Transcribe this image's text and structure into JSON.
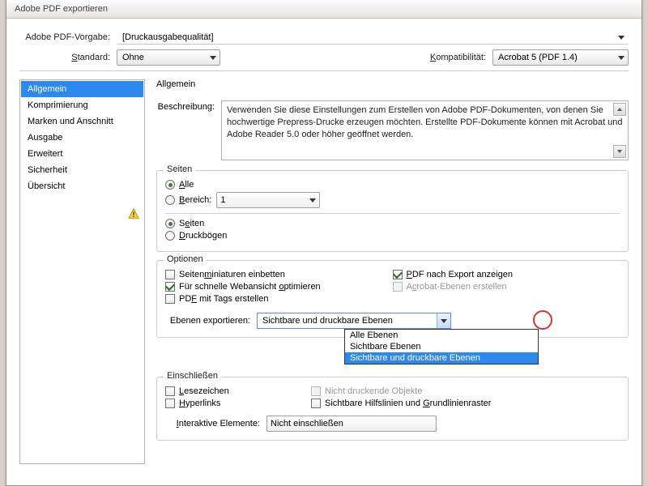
{
  "window": {
    "title": "Adobe PDF exportieren"
  },
  "preset": {
    "label": "Adobe PDF-Vorgabe:",
    "value": "[Druckausgabequalität]"
  },
  "standard": {
    "label": "Standard:",
    "value": "Ohne"
  },
  "compat": {
    "label": "Kompatibilität:",
    "value": "Acrobat 5 (PDF 1.4)"
  },
  "sidebar": {
    "items": [
      {
        "label": "Allgemein",
        "selected": true
      },
      {
        "label": "Komprimierung"
      },
      {
        "label": "Marken und Anschnitt"
      },
      {
        "label": "Ausgabe"
      },
      {
        "label": "Erweitert"
      },
      {
        "label": "Sicherheit"
      },
      {
        "label": "Übersicht",
        "warn": true
      }
    ]
  },
  "general": {
    "heading": "Allgemein",
    "desc_label": "Beschreibung:",
    "desc": "Verwenden Sie diese Einstellungen zum Erstellen von Adobe PDF-Dokumenten, von denen Sie hochwertige Prepress-Drucke erzeugen möchten. Erstellte PDF-Dokumente können mit Acrobat und Adobe Reader 5.0 oder höher geöffnet werden.",
    "pages": {
      "title": "Seiten",
      "all": "Alle",
      "range": "Bereich:",
      "range_value": "1",
      "pages_radio": "Seiten",
      "spreads": "Druckbögen"
    },
    "options": {
      "title": "Optionen",
      "thumbs": "Seitenminiaturen einbetten",
      "fastweb": "Für schnelle Webansicht optimieren",
      "tagged": "PDF mit Tags erstellen",
      "view_after": "PDF nach Export anzeigen",
      "acrobat_layers": "Acrobat-Ebenen erstellen",
      "export_layers_label": "Ebenen exportieren:",
      "export_layers_value": "Sichtbare und druckbare Ebenen",
      "export_layers_options": [
        "Alle Ebenen",
        "Sichtbare Ebenen",
        "Sichtbare und druckbare Ebenen"
      ]
    },
    "include": {
      "title": "Einschließen",
      "bookmarks": "Lesezeichen",
      "hyperlinks": "Hyperlinks",
      "nonprinting": "Nicht druckende Objekte",
      "guides": "Sichtbare Hilfslinien und Grundlinienraster",
      "interactive_label": "Interaktive Elemente:",
      "interactive_value": "Nicht einschließen"
    }
  }
}
